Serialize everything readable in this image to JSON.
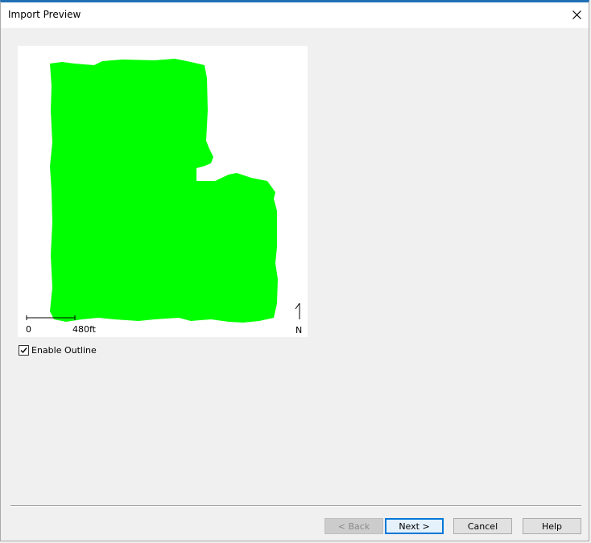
{
  "window": {
    "title": "Import Preview",
    "accent_color": "#1f6fb5"
  },
  "preview": {
    "outline_color": "#00ff00",
    "scale": {
      "min_label": "0",
      "max_label": "480ft"
    },
    "north_label": "N"
  },
  "options": {
    "enable_outline_label": "Enable Outline",
    "enable_outline_checked": true
  },
  "buttons": {
    "back": "< Back",
    "next": "Next >",
    "cancel": "Cancel",
    "help": "Help"
  },
  "icons": {
    "close": "close-icon",
    "north_arrow": "north-arrow-icon",
    "check": "checkmark-icon"
  }
}
